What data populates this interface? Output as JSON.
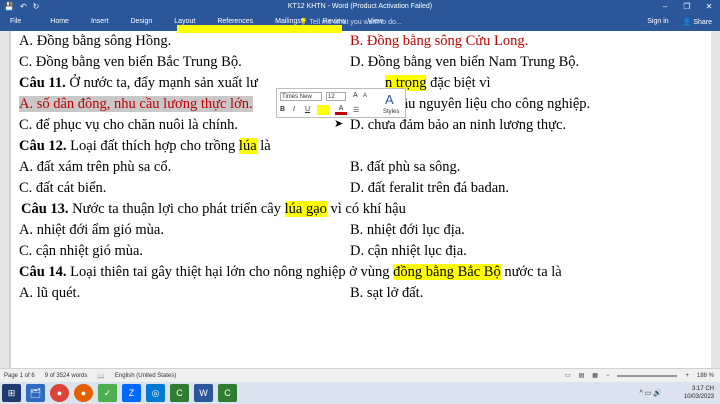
{
  "window": {
    "title": "KT12 KHTN - Word (Product Activation Failed)",
    "controls": [
      "–",
      "❐",
      "✕"
    ]
  },
  "ribbon": {
    "tabs": [
      "File",
      "Home",
      "Insert",
      "Design",
      "Layout",
      "References",
      "Mailings",
      "Review",
      "View"
    ],
    "tell_me": "Tell me what you want to do...",
    "sign_in": "Sign in",
    "share": "Share"
  },
  "document": {
    "lines": [
      {
        "a": "A. Đồng bằng sông Hồng.",
        "b": "B. Đồng bằng sông Cửu Long."
      },
      {
        "a": "C. Đồng bằng ven biển Bắc Trung Bộ.",
        "b": "D. Đồng bằng ven biển Nam Trung Bộ."
      },
      {
        "q_pre": "Câu 11.",
        "q_text": " Ở nước ta, đẩy mạnh sản xuất lư",
        "q_hl": "n trọng",
        "q_post": " đặc biệt vì"
      },
      {
        "a": "A. số dân đông, nhu cầu lương thực lớn.",
        "b": "B. nhu cầu nguyên liệu cho công nghiệp."
      },
      {
        "a": "C. để phục vụ cho chăn nuôi là chính.",
        "b": "D. chưa đảm bảo an ninh lương thực."
      },
      {
        "q_pre": "Câu 12.",
        "q_text": " Loại đất thích hợp cho trồng ",
        "q_hl": "lúa",
        "q_post": " là"
      },
      {
        "a": "A. đất xám trên phù sa cổ.",
        "b": "B. đất phù sa sông."
      },
      {
        "a": "C. đất cát biển.",
        "b": "D. đất feralit trên đá badan."
      },
      {
        "q_pre": "Câu 13.",
        "q_text": " Nước ta thuận lợi cho phát triển cây ",
        "q_hl": "lúa gạo",
        "q_post": " vì có khí hậu"
      },
      {
        "a": "A. nhiệt đới ẩm gió mùa.",
        "b": "B. nhiệt đới lục địa."
      },
      {
        "a": "C. cận nhiệt gió mùa.",
        "b": "D. cận nhiệt lục địa."
      },
      {
        "q_pre": "Câu 14.",
        "q_text": "  Loại thiên tai gây thiệt hại lớn cho nông nghiệp ở vùng ",
        "q_hl": "đồng bằng Bắc Bộ",
        "q_post": " nước ta là"
      },
      {
        "a": "A. lũ quét.",
        "b": "B. sạt lở đất."
      }
    ]
  },
  "minibar": {
    "font": "Times New Ro",
    "size": "12",
    "bold": "B",
    "italic": "I",
    "underline": "U",
    "font_color": "A",
    "styles": "Styles",
    "grow": "A",
    "shrink": "A",
    "list": "☰"
  },
  "status": {
    "page": "Page 1 of 6",
    "words": "9 of 3524 words",
    "language": "English (United States)",
    "zoom": "188 %"
  },
  "taskbar": {
    "time": "3:17 CH",
    "date": "10/03/2023"
  }
}
